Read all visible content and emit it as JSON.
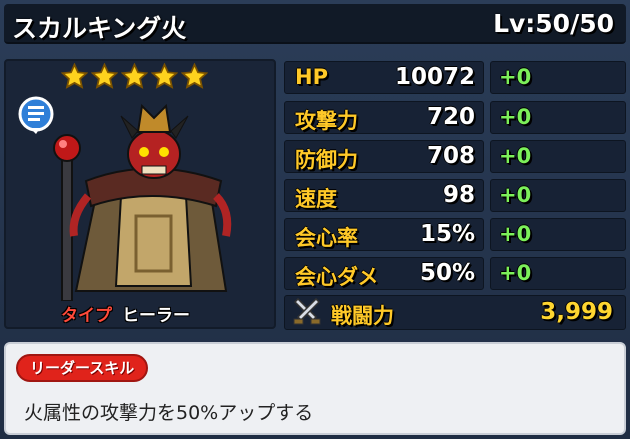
{
  "header": {
    "name": "スカルキング火",
    "level": "Lv:50/50"
  },
  "portrait": {
    "star_count": 5,
    "star_color": "#ffd21e",
    "type_label": "タイプ",
    "type_value": "ヒーラー"
  },
  "stats": [
    {
      "label": "HP",
      "value": "10072",
      "bonus": "+0"
    },
    {
      "label": "攻撃力",
      "value": "720",
      "bonus": "+0"
    },
    {
      "label": "防御力",
      "value": "708",
      "bonus": "+0"
    },
    {
      "label": "速度",
      "value": "98",
      "bonus": "+0"
    },
    {
      "label": "会心率",
      "value": "15%",
      "bonus": "+0"
    },
    {
      "label": "会心ダメ",
      "value": "50%",
      "bonus": "+0"
    }
  ],
  "power": {
    "label": "戦闘力",
    "value": "3,999"
  },
  "leader_skill": {
    "tag": "リーダースキル",
    "description": "火属性の攻撃力を50%アップする"
  },
  "colors": {
    "stat_label": "#ffc928",
    "bonus": "#7cf05a",
    "skill_tag": "#e0231b"
  }
}
